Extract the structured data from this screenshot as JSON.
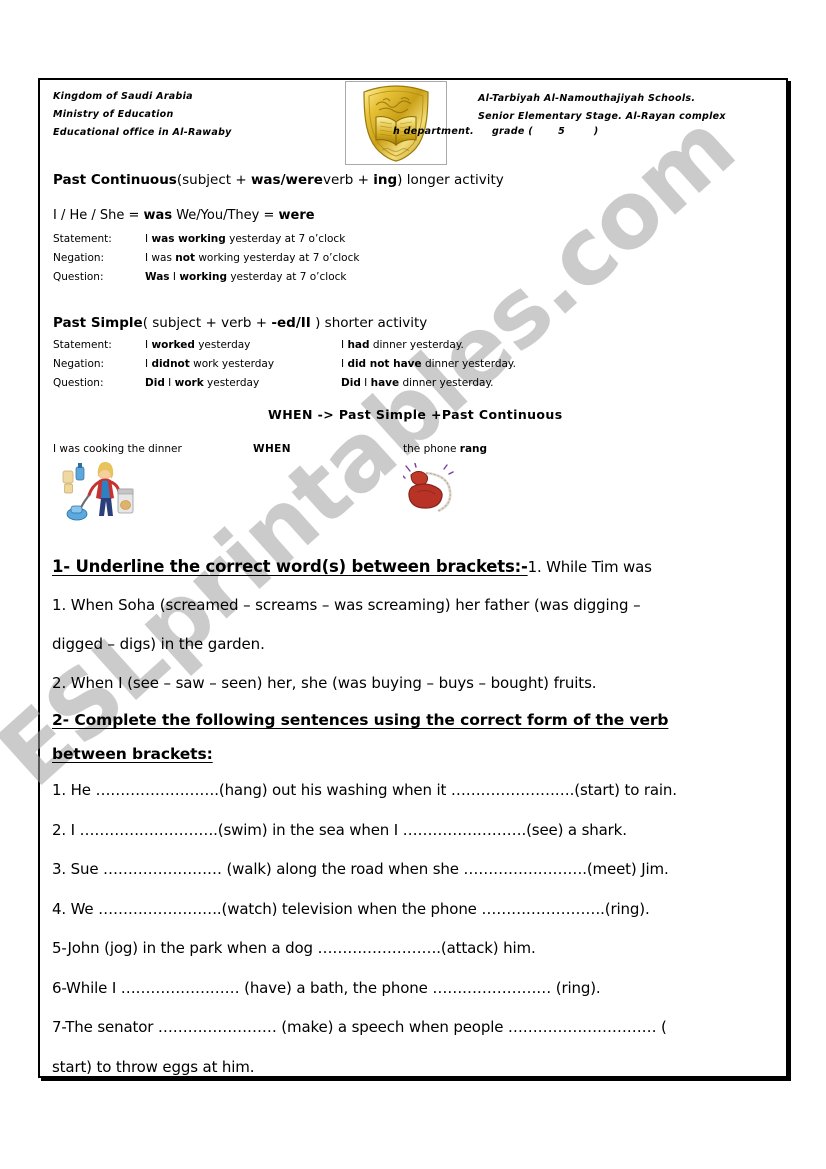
{
  "document": {
    "watermark": "ESLprintables.com"
  },
  "header": {
    "left_lines": [
      "Kingdom of Saudi Arabia",
      "Ministry of Education",
      "Educational office in Al-Rawaby"
    ],
    "right_lines": [
      "Al-Tarbiyah  Al-Namouthajiyah  Schools.",
      "Senior Elementary Stage. Al-Rayan complex"
    ],
    "third_line": "h department.     grade (       5        )",
    "logo_name": "saudi-ministry-of-education-emblem"
  },
  "grammar": {
    "past_continuous": {
      "title_bold": "Past Continuous",
      "title_rest": "(subject + ",
      "title_bold2": "was/were",
      "title_rest2": "verb + ",
      "title_bold3": "ing",
      "title_rest3": ")    longer activity",
      "pronouns_plain1": "I / He / She = ",
      "pronouns_bold1": "was",
      "pronouns_plain2": "   We/You/They = ",
      "pronouns_bold2": "were",
      "rows": [
        {
          "label": "Statement:",
          "text": "I was working yesterday at 7 o’clock",
          "bold_parts": [
            "was working"
          ]
        },
        {
          "label": "Negation:",
          "text": "I was not working yesterday at 7 o’clock",
          "bold_parts": [
            "not"
          ]
        },
        {
          "label": "Question:",
          "text": "Was I working yesterday at 7 o’clock",
          "bold_parts": [
            "Was",
            "working"
          ]
        }
      ]
    },
    "past_simple": {
      "title_bold": "Past Simple",
      "title_rest": "( subject + verb + ",
      "title_bold2": "-ed/II",
      "title_rest2": " )   shorter activity",
      "rows": [
        {
          "label": "Statement:",
          "col1": "I worked yesterday",
          "col2": "I had dinner yesterday."
        },
        {
          "label": "Negation:",
          "col1": "I didnot work yesterday",
          "col2": "I did not have dinner yesterday."
        },
        {
          "label": "Question:",
          "col1": "Did I work yesterday",
          "col2": "Did I have dinner yesterday."
        }
      ]
    },
    "when_rule": "WHEN  -> Past Simple +Past Continuous"
  },
  "example": {
    "left_text": "I was cooking the dinner",
    "middle_text": "WHEN",
    "right_text": "the phone rang",
    "right_bold": "rang",
    "left_image_name": "woman-vacuuming-cleaning-clipart",
    "right_image_name": "red-ringing-telephone-clipart"
  },
  "exercise1": {
    "number_title": "1-  Underline  the  correct  word(s)  between  brackets:-",
    "trailing": "1. While Tim was",
    "items": [
      "1. When Soha (screamed – screams – was screaming) her father (was digging –",
      "digged – digs) in the garden.",
      "2. When I (see – saw – seen) her, she (was buying – buys – bought) fruits."
    ]
  },
  "exercise2": {
    "title_line1": "2- Complete  the  following  sentences  using  the  correct  form  of  the  verb",
    "title_line2": "between  brackets:",
    "items": [
      "1. He …………………….(hang) out his washing when it …………………….(start) to rain.",
      "2. I ……………………….(swim) in the sea when I …………………….(see) a shark.",
      "3. Sue …………………… (walk) along the road when she …………………….(meet) Jim.",
      "4. We …………………….(watch) television when the phone …………………….(ring).",
      "5-John (jog) in the park when a dog …………………….(attack) him.",
      "6-While I …………………… (have) a bath, the phone ……………………  (ring).",
      "7-The senator   …………………… (make) a speech when people ………………………… (",
      "start) to throw eggs at him."
    ]
  }
}
